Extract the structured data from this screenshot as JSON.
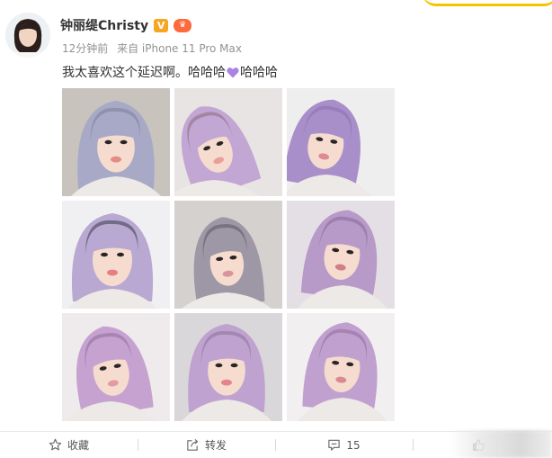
{
  "post": {
    "author_name": "钟丽缇Christy",
    "verified_badge": "V",
    "member_badge_icon": "vip-crown-icon",
    "time": "12分钟前",
    "source": "来自 iPhone 11 Pro Max",
    "text_before": "我太喜欢这个延迟啊。哈哈哈",
    "heart_icon": "purple-heart-icon",
    "text_after": "哈哈哈",
    "photo_count": 9
  },
  "actions": {
    "favorite_label": "收藏",
    "repost_label": "转发",
    "comment_count": "15",
    "like_count": ""
  },
  "colors": {
    "hair_lavender": "#b9a2cf",
    "hair_lavender_dark": "#8e79ac",
    "heart_purple": "#a983e6",
    "verified_orange": "#f6a623"
  }
}
